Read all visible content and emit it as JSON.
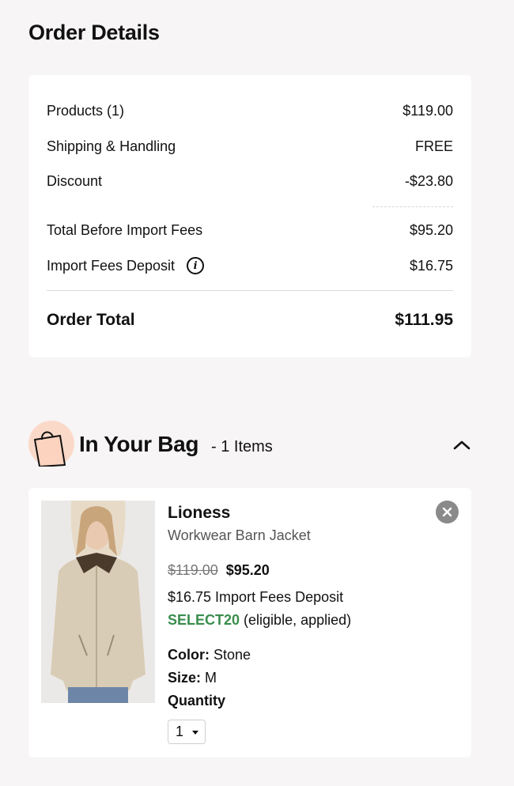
{
  "order_details": {
    "title": "Order Details",
    "rows": [
      {
        "label": "Products (1)",
        "value": "$119.00"
      },
      {
        "label": "Shipping & Handling",
        "value": "FREE"
      },
      {
        "label": "Discount",
        "value": "-$23.80"
      },
      {
        "label": "Total Before Import Fees",
        "value": "$95.20"
      },
      {
        "label": "Import Fees Deposit",
        "value": "$16.75"
      }
    ],
    "total": {
      "label": "Order Total",
      "value": "$111.95"
    }
  },
  "bag": {
    "title": "In Your Bag",
    "count": "- 1 Items",
    "items": [
      {
        "brand": "Lioness",
        "name": "Workwear Barn Jacket",
        "original_price": "$119.00",
        "sale_price": "$95.20",
        "import_fees": "$16.75 Import Fees Deposit",
        "promo_code": "SELECT20",
        "promo_status": "(eligible, applied)",
        "color_label": "Color:",
        "color_value": "Stone",
        "size_label": "Size:",
        "size_value": "M",
        "quantity_label": "Quantity",
        "quantity_value": "1"
      }
    ]
  },
  "colors": {
    "background": "#f7f5f5",
    "card": "#ffffff",
    "promo_green": "#3a8d4d",
    "bag_icon_bg": "#fbd9c9"
  },
  "icons": [
    "info-icon",
    "shopping-bag-icon",
    "chevron-up-icon",
    "close-icon",
    "caret-down-icon"
  ]
}
